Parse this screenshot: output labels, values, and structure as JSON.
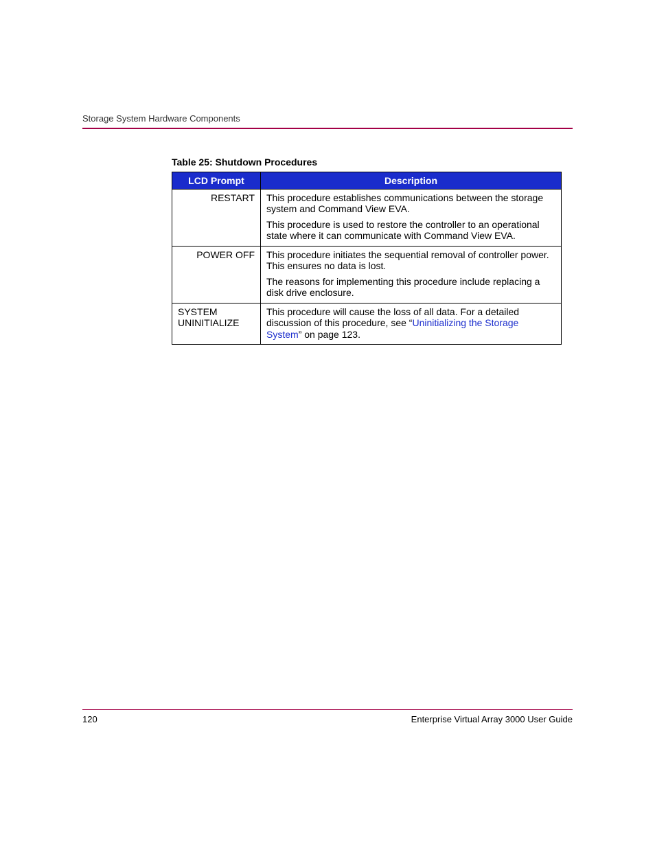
{
  "header": {
    "section": "Storage System Hardware Components"
  },
  "table": {
    "caption": "Table 25:  Shutdown Procedures",
    "columns": {
      "c1": "LCD Prompt",
      "c2": "Description"
    },
    "rows": [
      {
        "prompt": "RESTART",
        "paras": [
          "This procedure establishes communications between the storage system and Command View EVA.",
          "This procedure is used to restore the controller to an operational state where it can communicate with Command View EVA."
        ]
      },
      {
        "prompt": "POWER OFF",
        "paras": [
          "This procedure initiates the sequential removal of controller power. This ensures no data is lost.",
          "The reasons for implementing this procedure include replacing a disk drive enclosure."
        ]
      },
      {
        "prompt": "SYSTEM UNINITIALIZE",
        "desc_prefix": "This procedure will cause the loss of all data. For a detailed discussion of this procedure, see “",
        "desc_link": "Uninitializing the Storage System",
        "desc_suffix": "” on page 123."
      }
    ]
  },
  "footer": {
    "page": "120",
    "doc": "Enterprise Virtual Array 3000 User Guide"
  }
}
